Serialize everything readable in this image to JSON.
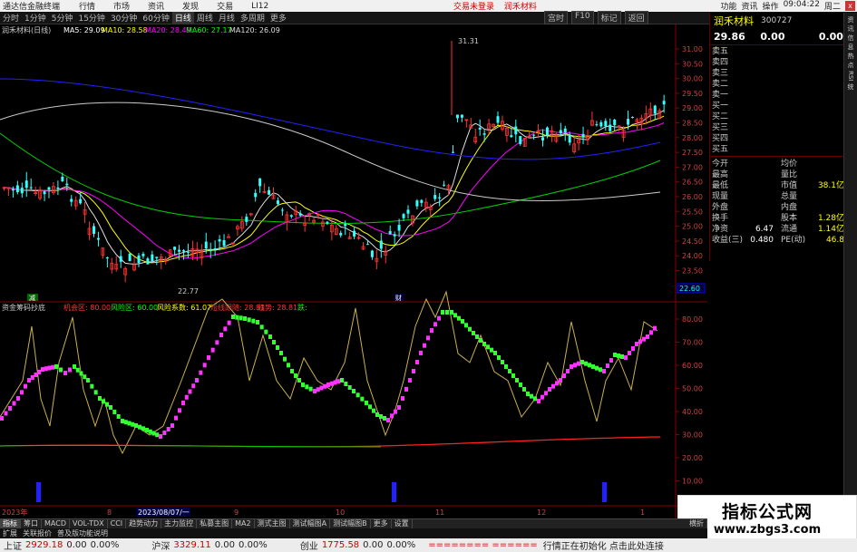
{
  "titlebar": {
    "app_name": "通达信金融终端",
    "menus": [
      "行情",
      "市场",
      "资讯",
      "发现",
      "交易",
      "LI12"
    ],
    "center_items": [
      "交易未登录",
      "润禾材料"
    ],
    "right_items": [
      "功能",
      "资讯",
      "操作",
      "09:04:22",
      "周二"
    ],
    "close": "x"
  },
  "periodbar": {
    "items": [
      "分时",
      "1分钟",
      "5分钟",
      "15分钟",
      "30分钟",
      "60分钟",
      "日线",
      "周线",
      "月线",
      "多周期",
      "更多"
    ],
    "active_index": 6,
    "right_items": [
      "宫时",
      "F10",
      "标记",
      "返回"
    ]
  },
  "price_chart": {
    "header": [
      "润禾材料(日线)",
      "MA5: 29.09",
      "MA10: 28.58",
      "MA20: 28.49",
      "MA60: 27.17",
      "MA120: 26.09"
    ],
    "y_ticks": [
      "31.00",
      "30.50",
      "30.00",
      "29.50",
      "29.00",
      "28.50",
      "28.00",
      "27.50",
      "27.00",
      "26.50",
      "26.00",
      "25.50",
      "25.00",
      "24.50",
      "24.00",
      "23.50"
    ],
    "high_label": "31.31",
    "low_label": "22.77",
    "current_price_label": "22.60",
    "marker_left": "减",
    "marker_mid": "财"
  },
  "indicator": {
    "header": [
      "资金筹码抄底",
      "机会区: 80.00",
      "风险区: 60.00",
      "风险系数: 61.07",
      "短线跟随: 28.81",
      "趋势: 28.81",
      "跌:"
    ],
    "y_ticks": [
      "80.00",
      "70.00",
      "60.00",
      "50.00",
      "40.00",
      "30.00",
      "20.00",
      "10.00"
    ],
    "x_labels": [
      "2023年",
      "8",
      "2023/08/07/一",
      "9",
      "10",
      "11",
      "12",
      "1"
    ]
  },
  "sidebar": {
    "name": "润禾材料",
    "code": "300727",
    "last": "29.86",
    "change": "0.00",
    "pct": "0.00%",
    "orderbook": [
      "卖五",
      "卖四",
      "卖三",
      "卖二",
      "卖一",
      "买一",
      "买二",
      "买三",
      "买四",
      "买五"
    ],
    "stats": [
      {
        "l": "今开",
        "v1": "",
        "l2": "均价",
        "v2": ""
      },
      {
        "l": "最高",
        "v1": "",
        "l2": "量比",
        "v2": ""
      },
      {
        "l": "最低",
        "v1": "",
        "l2": "市值",
        "v2": "38.1亿"
      },
      {
        "l": "现量",
        "v1": "",
        "l2": "总量",
        "v2": ""
      },
      {
        "l": "外盘",
        "v1": "",
        "l2": "内盘",
        "v2": ""
      },
      {
        "l": "换手",
        "v1": "",
        "l2": "股本",
        "v2": "1.28亿"
      },
      {
        "l": "净资",
        "v1": "6.47",
        "l2": "流通",
        "v2": "1.14亿"
      },
      {
        "l": "收益(三)",
        "v1": "0.480",
        "l2": "PE(动)",
        "v2": "46.8"
      }
    ]
  },
  "right_strip": [
    "资",
    "讯",
    "信",
    "息",
    "热",
    "点",
    "RSI",
    "统"
  ],
  "watermark": {
    "line1": "指标公式网",
    "line2": "www.zbgs3.com"
  },
  "tabs": [
    "指标",
    "筹口",
    "MACD",
    "VOL-TDX",
    "CCI",
    "趋势动力",
    "主力监控",
    "私募主图",
    "MA2",
    "测式主图",
    "测试幅图A",
    "测试幅图B",
    "更多",
    "设置"
  ],
  "tabs_active_index": 0,
  "extbar": [
    "扩展",
    "关联报价",
    "普及版功能说明"
  ],
  "right_tail": "横折",
  "statusbar": {
    "sh_label": "上证",
    "sh_val": "2929.18",
    "sh_chg": "0.00",
    "sh_pct": "0.00%",
    "hs_label": "沪深",
    "hs_val": "3329.11",
    "hs_chg": "0.00",
    "hs_pct": "0.00%",
    "cy_label": "创业",
    "cy_val": "1775.58",
    "cy_chg": "0.00",
    "cy_pct": "0.00%",
    "warn": "======== ======",
    "msg": "行情正在初始化 点击此处连接"
  }
}
